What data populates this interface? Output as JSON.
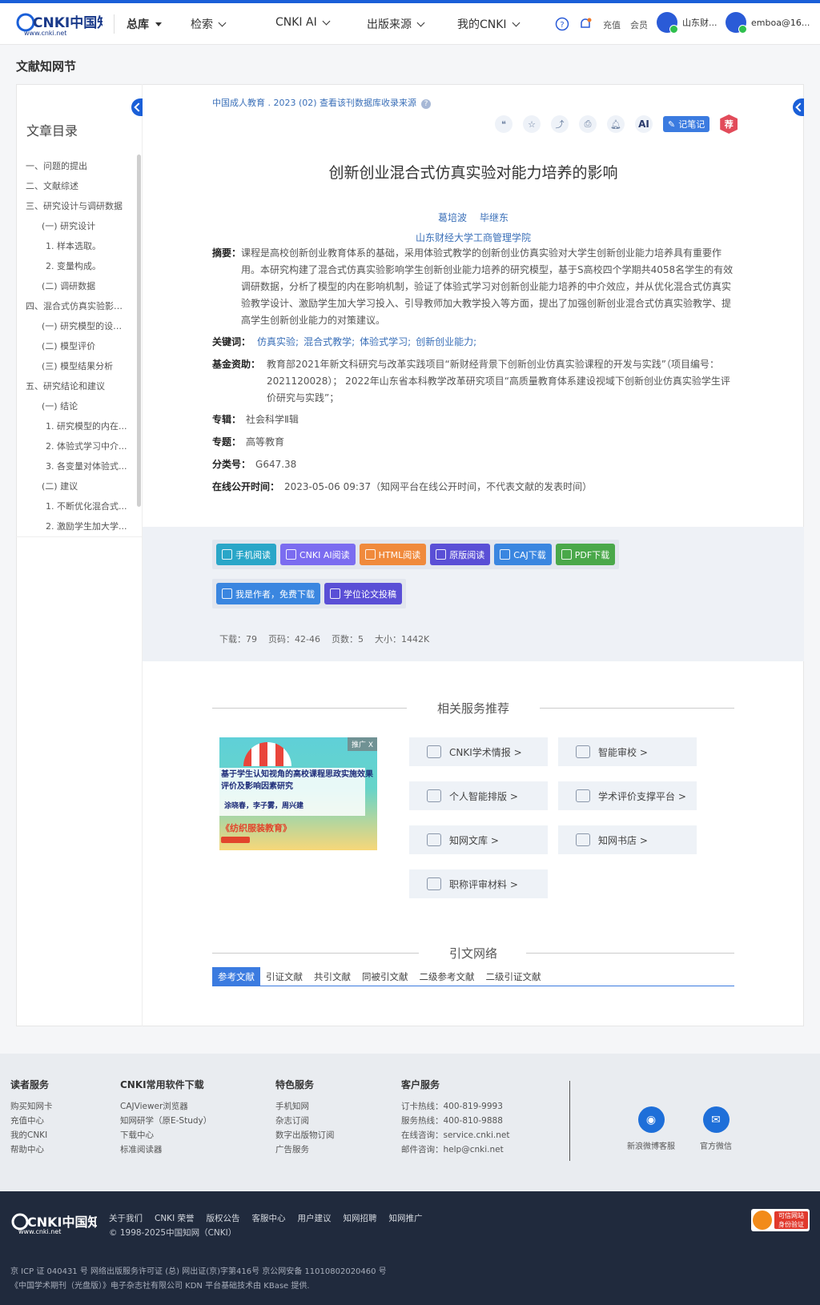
{
  "header": {
    "logo_text": "CNKI中国知网",
    "logo_url_text": "www.cnki.net",
    "nav": [
      "总库",
      "检索",
      "CNKI AI",
      "出版来源",
      "我的CNKI"
    ],
    "recharge": "充值",
    "member": "会员",
    "institution": "山东财...",
    "username": "emboa@16..."
  },
  "page_title": "文献知网节",
  "toc": {
    "title": "文章目录",
    "items": [
      {
        "label": "一、问题的提出",
        "level": 1
      },
      {
        "label": "二、文献综述",
        "level": 1
      },
      {
        "label": "三、研究设计与调研数据",
        "level": 1
      },
      {
        "label": "(一) 研究设计",
        "level": 2
      },
      {
        "label": "1. 样本选取。",
        "level": 3
      },
      {
        "label": "2. 变量构成。",
        "level": 3
      },
      {
        "label": "(二) 调研数据",
        "level": 2
      },
      {
        "label": "四、混合式仿真实验影响...",
        "level": 1
      },
      {
        "label": "(一) 研究模型的设定...",
        "level": 2
      },
      {
        "label": "(二) 模型评价",
        "level": 2
      },
      {
        "label": "(三) 模型结果分析",
        "level": 2
      },
      {
        "label": "五、研究结论和建议",
        "level": 1
      },
      {
        "label": "(一) 结论",
        "level": 2
      },
      {
        "label": "1. 研究模型的内在...",
        "level": 3
      },
      {
        "label": "2. 体验式学习中介...",
        "level": 3
      },
      {
        "label": "3. 各变量对体验式...",
        "level": 3
      },
      {
        "label": "(二) 建议",
        "level": 2
      },
      {
        "label": "1. 不断优化混合式...",
        "level": 3
      },
      {
        "label": "2. 激励学生加大学...",
        "level": 3
      }
    ]
  },
  "article": {
    "source": "中国成人教育 . 2023 (02)   查看该刊数据库收录来源",
    "note_label": "记笔记",
    "rec_label": "荐",
    "ai_label": "AI",
    "title": "创新创业混合式仿真实验对能力培养的影响",
    "authors": [
      "葛培波",
      "毕继东"
    ],
    "org": "山东财经大学工商管理学院",
    "abstract_label": "摘要：",
    "abstract": "课程是高校创新创业教育体系的基础，采用体验式教学的创新创业仿真实验对大学生创新创业能力培养具有重要作用。本研究构建了混合式仿真实验影响学生创新创业能力培养的研究模型，基于S高校四个学期共4058名学生的有效调研数据，分析了模型的内在影响机制，验证了体验式学习对创新创业能力培养的中介效应，并从优化混合式仿真实验教学设计、激励学生加大学习投入、引导教师加大教学投入等方面，提出了加强创新创业混合式仿真实验教学、提高学生创新创业能力的对策建议。",
    "keywords_label": "关键词：",
    "keywords": [
      "仿真实验;",
      "混合式教学;",
      "体验式学习;",
      "创新创业能力;"
    ],
    "fund_label": "基金资助：",
    "fund": "教育部2021年新文科研究与改革实践项目“新财经背景下创新创业仿真实验课程的开发与实践”（项目编号：2021120028）；  2022年山东省本科教学改革研究项目“高质量教育体系建设视域下创新创业仿真实验学生评价研究与实践”；",
    "series_label": "专辑：",
    "series": "社会科学Ⅱ辑",
    "topic_label": "专题：",
    "topic": "高等教育",
    "class_label": "分类号：",
    "class": "G647.38",
    "online_label": "在线公开时间：",
    "online": "2023-05-06 09:37（知网平台在线公开时间，不代表文献的发表时间）"
  },
  "downloads": {
    "row1": [
      {
        "label": "手机阅读",
        "color": "#2aa6c8"
      },
      {
        "label": "CNKI AI阅读",
        "color": "#7b6cf0"
      },
      {
        "label": "HTML阅读",
        "color": "#f08a3c"
      },
      {
        "label": "原版阅读",
        "color": "#5a4fd6"
      },
      {
        "label": "CAJ下载",
        "color": "#3a86e0"
      },
      {
        "label": "PDF下载",
        "color": "#4aa84a"
      }
    ],
    "row2": [
      {
        "label": "我是作者，免费下载",
        "color": "#3a86e0"
      },
      {
        "label": "学位论文投稿",
        "color": "#5a4fd6"
      }
    ],
    "stats": [
      "下载：79",
      "页码：42-46",
      "页数：5",
      "大小：1442K"
    ]
  },
  "related": {
    "title": "相关服务推荐",
    "ad": {
      "tag": "推广 X",
      "line1": "基于学生认知视角的高校课程思政实施效果评价及影响因素研究",
      "line2": "涂晓春，李子雾，周兴建",
      "line3": "《纺织服装教育》"
    },
    "services": [
      "CNKI学术情报 >",
      "智能审校 >",
      "个人智能排版 >",
      "学术评价支撑平台 >",
      "知网文库 >",
      "知网书店 >",
      "职称评审材料 >"
    ]
  },
  "citation": {
    "title": "引文网络",
    "tabs": [
      "参考文献",
      "引证文献",
      "共引文献",
      "同被引文献",
      "二级参考文献",
      "二级引证文献"
    ]
  },
  "footer": {
    "cols": [
      {
        "title": "读者服务",
        "items": [
          "购买知网卡",
          "充值中心",
          "我的CNKI",
          "帮助中心"
        ]
      },
      {
        "title": "CNKI常用软件下载",
        "items": [
          "CAJViewer浏览器",
          "知网研学（原E-Study）",
          "下载中心",
          "标准阅读器"
        ]
      },
      {
        "title": "特色服务",
        "items": [
          "手机知网",
          "杂志订阅",
          "数字出版物订阅",
          "广告服务"
        ]
      },
      {
        "title": "客户服务",
        "items": [
          "订卡热线：400-819-9993",
          "服务热线：400-810-9888",
          "在线咨询：service.cnki.net",
          "邮件咨询：help@cnki.net"
        ]
      }
    ],
    "weibo": "新浪微博客服",
    "wechat": "官方微信",
    "links": [
      "关于我们",
      "CNKI 荣誉",
      "版权公告",
      "客服中心",
      "用户建议",
      "知网招聘",
      "知网推广"
    ],
    "copyright": "© 1998-2025中国知网（CNKI）",
    "icp": "京 ICP 证 040431 号  网络出版服务许可证 (总) 网出证(京)字第416号   京公网安备 11010802020460 号",
    "publisher": "《中国学术期刊（光盘版）》电子杂志社有限公司   KDN 平台基础技术由 KBase 提供.",
    "trust": "可信网站 身份验证"
  }
}
